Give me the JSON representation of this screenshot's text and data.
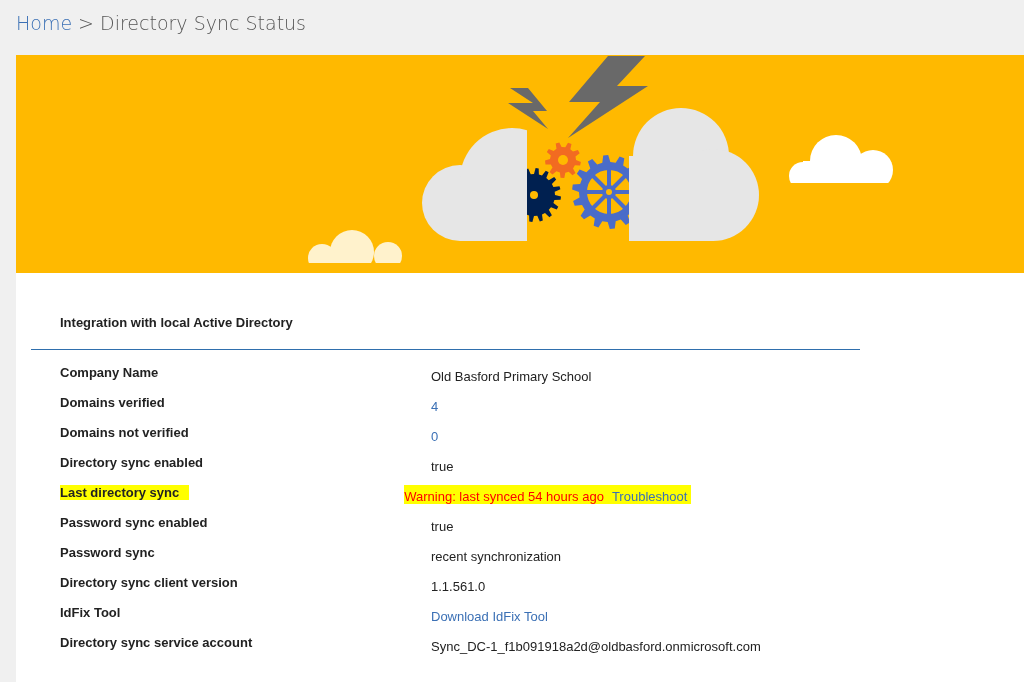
{
  "breadcrumb": {
    "items": [
      "Home",
      "Directory Sync Status"
    ],
    "separator": ">"
  },
  "section": {
    "title": "Integration with local Active Directory",
    "rows": [
      {
        "label": "Company Name",
        "highlighted": false,
        "value": [
          {
            "kind": "text",
            "text": "Old Basford Primary School"
          }
        ]
      },
      {
        "label": "Domains verified",
        "highlighted": false,
        "value": [
          {
            "kind": "link",
            "text": "4"
          }
        ]
      },
      {
        "label": "Domains not verified",
        "highlighted": false,
        "value": [
          {
            "kind": "link",
            "text": "0"
          }
        ]
      },
      {
        "label": "Directory sync enabled",
        "highlighted": false,
        "value": [
          {
            "kind": "text",
            "text": "true"
          }
        ]
      },
      {
        "label": "Last directory sync",
        "highlighted": true,
        "value": [
          {
            "kind": "warning",
            "text": "Warning: last synced 54 hours ago"
          },
          {
            "kind": "link",
            "text": "Troubleshoot"
          }
        ]
      },
      {
        "label": "Password sync enabled",
        "highlighted": false,
        "value": [
          {
            "kind": "text",
            "text": "true"
          }
        ]
      },
      {
        "label": "Password sync",
        "highlighted": false,
        "value": [
          {
            "kind": "text",
            "text": "recent synchronization"
          }
        ]
      },
      {
        "label": "Directory sync client version",
        "highlighted": false,
        "value": [
          {
            "kind": "text",
            "text": "1.1.561.0"
          }
        ]
      },
      {
        "label": "IdFix Tool",
        "highlighted": false,
        "value": [
          {
            "kind": "link",
            "text": "Download IdFix Tool"
          }
        ]
      },
      {
        "label": "Directory sync service account",
        "highlighted": false,
        "value": [
          {
            "kind": "text",
            "text": "Sync_DC-1_f1b091918a2d@oldbasford.onmicrosoft.com"
          }
        ]
      }
    ]
  }
}
